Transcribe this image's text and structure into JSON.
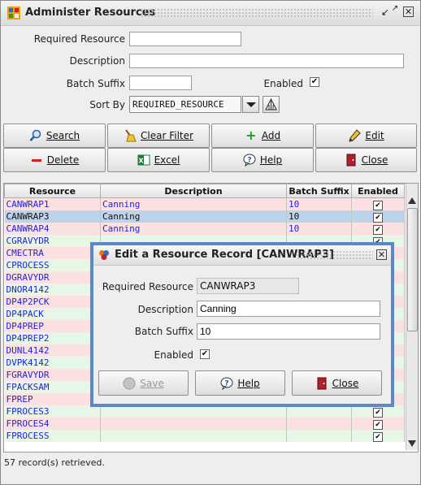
{
  "window": {
    "title": "Administer Resources"
  },
  "form": {
    "required_resource_label": "Required Resource",
    "required_resource_value": "",
    "description_label": "Description",
    "description_value": "",
    "batch_suffix_label": "Batch Suffix",
    "batch_suffix_value": "",
    "enabled_label": "Enabled",
    "enabled_checked": true,
    "sort_by_label": "Sort By",
    "sort_by_value": "REQUIRED_RESOURCE"
  },
  "buttons": {
    "search": "Search",
    "clear_filter": "Clear Filter",
    "add": "Add",
    "edit": "Edit",
    "delete": "Delete",
    "excel": "Excel",
    "help": "Help",
    "close": "Close"
  },
  "table": {
    "columns": [
      "Resource",
      "Description",
      "Batch Suffix",
      "Enabled"
    ],
    "rows": [
      {
        "resource": "CANWRAP1",
        "description": "Canning",
        "batch_suffix": "10",
        "enabled": true
      },
      {
        "resource": "CANWRAP3",
        "description": "Canning",
        "batch_suffix": "10",
        "enabled": true
      },
      {
        "resource": "CANWRAP4",
        "description": "Canning",
        "batch_suffix": "10",
        "enabled": true
      },
      {
        "resource": "CGRAVYDR",
        "description": "",
        "batch_suffix": "",
        "enabled": true
      },
      {
        "resource": "CMECTRA",
        "description": "",
        "batch_suffix": "",
        "enabled": true
      },
      {
        "resource": "CPROCESS",
        "description": "",
        "batch_suffix": "",
        "enabled": true
      },
      {
        "resource": "DGRAVYDR",
        "description": "",
        "batch_suffix": "",
        "enabled": true
      },
      {
        "resource": "DNOR4142",
        "description": "",
        "batch_suffix": "",
        "enabled": true
      },
      {
        "resource": "DP4P2PCK",
        "description": "",
        "batch_suffix": "",
        "enabled": true
      },
      {
        "resource": "DP4PACK",
        "description": "",
        "batch_suffix": "",
        "enabled": true
      },
      {
        "resource": "DP4PREP",
        "description": "",
        "batch_suffix": "",
        "enabled": true
      },
      {
        "resource": "DP4PREP2",
        "description": "",
        "batch_suffix": "",
        "enabled": true
      },
      {
        "resource": "DUNL4142",
        "description": "",
        "batch_suffix": "",
        "enabled": true
      },
      {
        "resource": "DVPK4142",
        "description": "",
        "batch_suffix": "",
        "enabled": true
      },
      {
        "resource": "FGRAVYDR",
        "description": "",
        "batch_suffix": "",
        "enabled": true
      },
      {
        "resource": "FPACKSAM",
        "description": "",
        "batch_suffix": "",
        "enabled": true
      },
      {
        "resource": "FPREP",
        "description": "",
        "batch_suffix": "",
        "enabled": true
      },
      {
        "resource": "FPROCES3",
        "description": "",
        "batch_suffix": "",
        "enabled": true
      },
      {
        "resource": "FPROCES4",
        "description": "",
        "batch_suffix": "",
        "enabled": true
      },
      {
        "resource": "FPROCESS",
        "description": "",
        "batch_suffix": "",
        "enabled": true
      }
    ],
    "selected_row": 1
  },
  "status": "57 record(s) retrieved.",
  "dialog": {
    "title": "Edit a Resource Record [CANWRAP3]",
    "required_resource_label": "Required Resource",
    "required_resource_value": "CANWRAP3",
    "description_label": "Description",
    "description_value": "Canning",
    "batch_suffix_label": "Batch Suffix",
    "batch_suffix_value": "10",
    "enabled_label": "Enabled",
    "enabled_checked": true,
    "save": "Save",
    "help": "Help",
    "close": "Close"
  },
  "colors": {
    "row_pink": "#fbe1e1",
    "row_green": "#e6f7e6",
    "row_selected": "#bdd3ea",
    "link_blue": "#2323d8",
    "dialog_border": "#5d88c6"
  }
}
